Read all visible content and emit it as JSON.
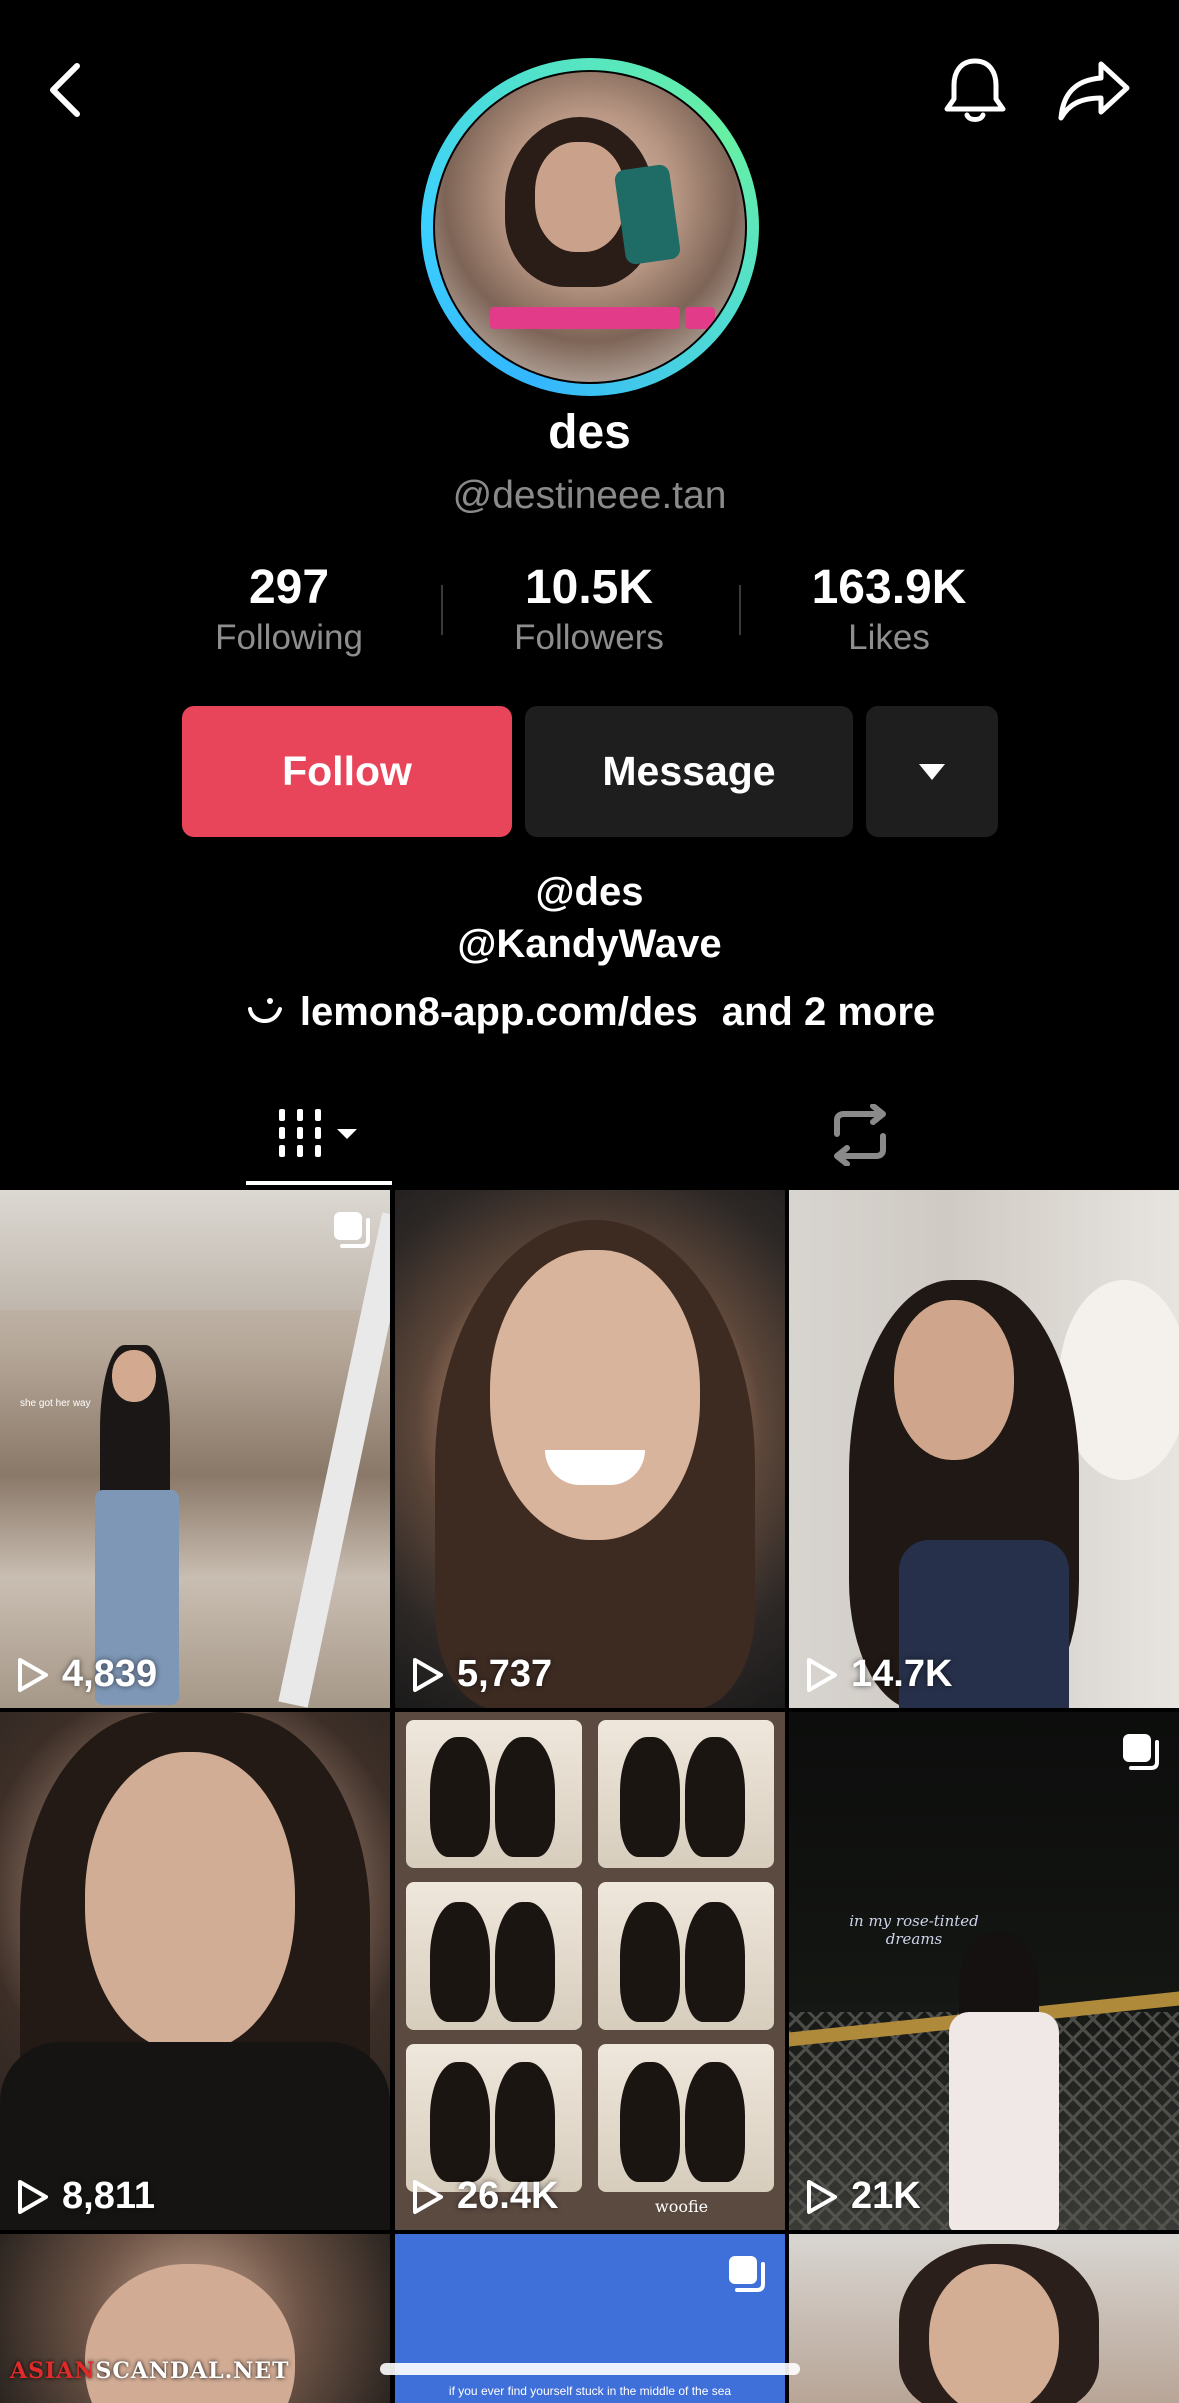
{
  "profile": {
    "display_name": "des",
    "username": "@destineee.tan"
  },
  "stats": [
    {
      "value": "297",
      "label": "Following"
    },
    {
      "value": "10.5K",
      "label": "Followers"
    },
    {
      "value": "163.9K",
      "label": "Likes"
    }
  ],
  "actions": {
    "follow_label": "Follow",
    "message_label": "Message"
  },
  "bio": {
    "line1": "@des",
    "line2": "@KandyWave",
    "link": "lemon8-app.com/des",
    "link_more": "and 2 more"
  },
  "icons": {
    "back": "chevron-left-icon",
    "bell": "bell-icon",
    "share": "share-arrow-icon",
    "more": "caret-down-icon",
    "videos_tab": "grid-icon",
    "reposts_tab": "repost-icon",
    "link": "lemon8-smile-icon",
    "play": "play-icon",
    "multi": "multi-photo-icon"
  },
  "videos": [
    {
      "views": "4,839",
      "multi": true,
      "caption": "she got her way"
    },
    {
      "views": "5,737",
      "multi": false
    },
    {
      "views": "14.7K",
      "multi": false
    },
    {
      "views": "8,811",
      "multi": false
    },
    {
      "views": "26.4K",
      "multi": false,
      "caption": "woofie"
    },
    {
      "views": "21K",
      "multi": true,
      "caption": "in my rose-tinted dreams"
    },
    {
      "views": "",
      "multi": false
    },
    {
      "views": "",
      "multi": true,
      "caption": "if you ever find yourself stuck in the middle of the sea"
    },
    {
      "views": "",
      "multi": false
    }
  ],
  "watermark": {
    "part1": "ASIAN",
    "part2": "SCANDAL",
    "part3": ".NET"
  },
  "colors": {
    "follow": "#e8455a",
    "secondary_button": "#1e1e1e",
    "muted_text": "#8a8a8a"
  }
}
